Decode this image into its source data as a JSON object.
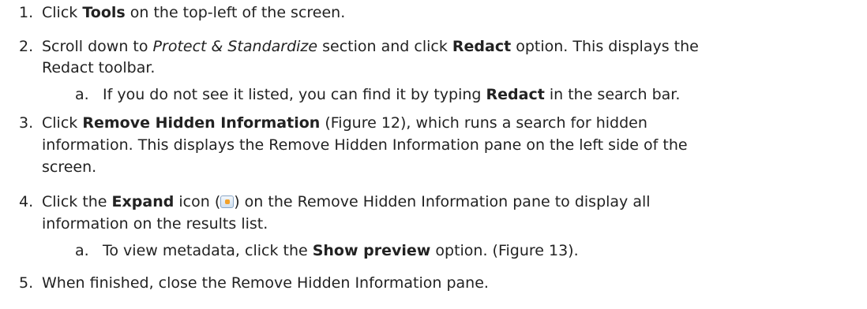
{
  "steps": [
    {
      "number": "1.",
      "parts": [
        "Click ",
        "Tools",
        " on the top-left of the screen."
      ]
    },
    {
      "number": "2.",
      "parts_line1": [
        "Scroll down to ",
        "Protect & Standardize",
        " section and click ",
        "Redact",
        " option.  This displays the"
      ],
      "line2": "Redact toolbar.",
      "sub": {
        "letter": "a.",
        "parts": [
          "If you do not see it listed, you can find it by typing ",
          "Redact",
          " in the search bar."
        ]
      }
    },
    {
      "number": "3.",
      "parts_line1": [
        "Click ",
        "Remove Hidden Information",
        " (Figure 12), which runs a search for hidden"
      ],
      "line2": "information.  This displays the Remove Hidden Information pane on the left side of the",
      "line3": "screen."
    },
    {
      "number": "4.",
      "parts_line1": [
        "Click the ",
        "Expand",
        " icon (",
        ") on the Remove Hidden Information pane to display all"
      ],
      "line2": "information on the results list.",
      "sub": {
        "letter": "a.",
        "parts": [
          "To view metadata, click the ",
          "Show preview",
          " option. (Figure 13)."
        ]
      }
    },
    {
      "number": "5.",
      "text": "When finished, close the Remove Hidden Information pane."
    }
  ],
  "icons": {
    "expand": "expand-icon"
  }
}
